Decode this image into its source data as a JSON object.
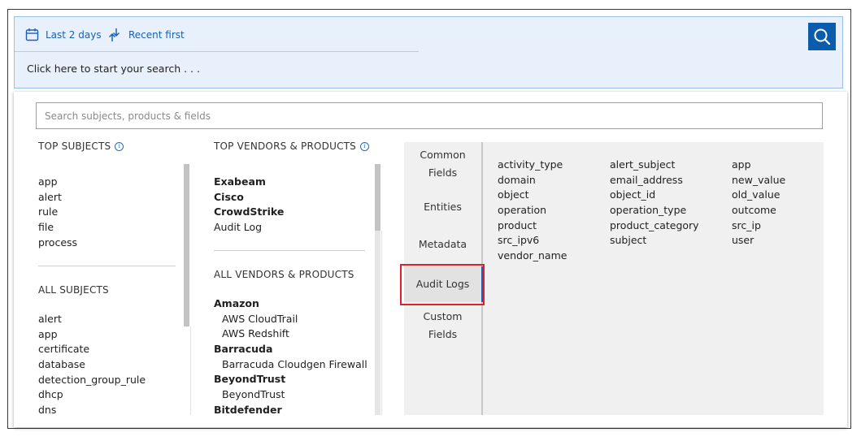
{
  "toolbar": {
    "time_range_label": "Last 2 days",
    "sort_label": "Recent first",
    "search_prompt": "Click here to start your search . . ."
  },
  "panel": {
    "search_placeholder": "Search subjects, products & fields",
    "top_subjects": {
      "heading": "TOP SUBJECTS",
      "items": [
        "app",
        "alert",
        "rule",
        "file",
        "process"
      ]
    },
    "all_subjects": {
      "heading": "ALL SUBJECTS",
      "items": [
        "alert",
        "app",
        "certificate",
        "database",
        "detection_group_rule",
        "dhcp",
        "dns"
      ]
    },
    "top_vendors": {
      "heading": "TOP VENDORS & PRODUCTS",
      "items": [
        {
          "label": "Exabeam",
          "bold": true
        },
        {
          "label": "Cisco",
          "bold": true
        },
        {
          "label": "CrowdStrike",
          "bold": true
        },
        {
          "label": "Audit Log",
          "bold": false
        }
      ]
    },
    "all_vendors": {
      "heading": "ALL VENDORS & PRODUCTS",
      "items": [
        {
          "label": "Amazon",
          "type": "vendor"
        },
        {
          "label": "AWS CloudTrail",
          "type": "product"
        },
        {
          "label": "AWS Redshift",
          "type": "product"
        },
        {
          "label": "Barracuda",
          "type": "vendor"
        },
        {
          "label": "Barracuda Cloudgen Firewall",
          "type": "product"
        },
        {
          "label": "BeyondTrust",
          "type": "vendor"
        },
        {
          "label": "BeyondTrust",
          "type": "product"
        },
        {
          "label": "Bitdefender",
          "type": "vendor"
        }
      ]
    },
    "field_tabs": [
      {
        "label": "Common\nFields",
        "active": false
      },
      {
        "label": "Entities",
        "active": false
      },
      {
        "label": "Metadata",
        "active": false
      },
      {
        "label": "Audit Logs",
        "active": true
      },
      {
        "label": "Custom\nFields",
        "active": false
      }
    ],
    "fields": [
      [
        "activity_type",
        "domain",
        "object",
        "operation",
        "product",
        "src_ipv6",
        "vendor_name"
      ],
      [
        "alert_subject",
        "email_address",
        "object_id",
        "operation_type",
        "product_category",
        "subject"
      ],
      [
        "app",
        "new_value",
        "old_value",
        "outcome",
        "src_ip",
        "user"
      ]
    ]
  },
  "colors": {
    "accent": "#1a5fb4",
    "search_button": "#0b5cad",
    "highlight": "#e0202a"
  },
  "icons": {
    "time_range": "calendar-icon",
    "sort": "sort-arrows-icon",
    "search": "search-icon",
    "info": "info-icon"
  }
}
